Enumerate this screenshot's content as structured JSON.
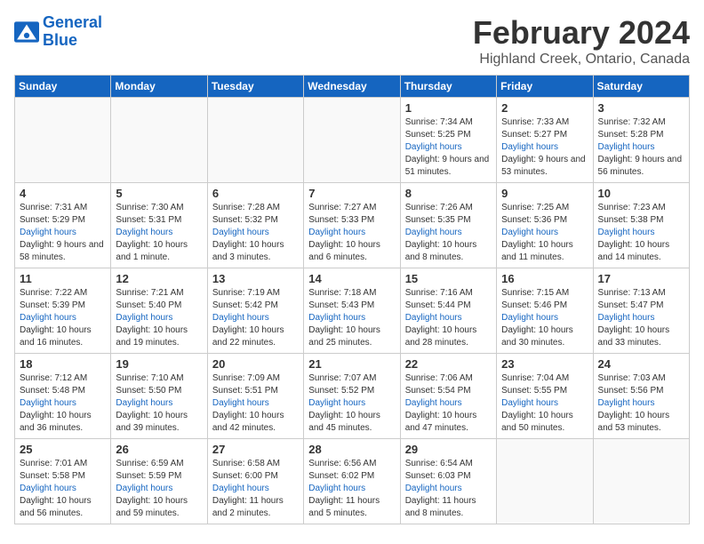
{
  "logo": {
    "line1": "General",
    "line2": "Blue"
  },
  "title": "February 2024",
  "location": "Highland Creek, Ontario, Canada",
  "days_of_week": [
    "Sunday",
    "Monday",
    "Tuesday",
    "Wednesday",
    "Thursday",
    "Friday",
    "Saturday"
  ],
  "weeks": [
    [
      {
        "num": "",
        "sunrise": "",
        "sunset": "",
        "daylight": ""
      },
      {
        "num": "",
        "sunrise": "",
        "sunset": "",
        "daylight": ""
      },
      {
        "num": "",
        "sunrise": "",
        "sunset": "",
        "daylight": ""
      },
      {
        "num": "",
        "sunrise": "",
        "sunset": "",
        "daylight": ""
      },
      {
        "num": "1",
        "sunrise": "Sunrise: 7:34 AM",
        "sunset": "Sunset: 5:25 PM",
        "daylight": "Daylight: 9 hours and 51 minutes."
      },
      {
        "num": "2",
        "sunrise": "Sunrise: 7:33 AM",
        "sunset": "Sunset: 5:27 PM",
        "daylight": "Daylight: 9 hours and 53 minutes."
      },
      {
        "num": "3",
        "sunrise": "Sunrise: 7:32 AM",
        "sunset": "Sunset: 5:28 PM",
        "daylight": "Daylight: 9 hours and 56 minutes."
      }
    ],
    [
      {
        "num": "4",
        "sunrise": "Sunrise: 7:31 AM",
        "sunset": "Sunset: 5:29 PM",
        "daylight": "Daylight: 9 hours and 58 minutes."
      },
      {
        "num": "5",
        "sunrise": "Sunrise: 7:30 AM",
        "sunset": "Sunset: 5:31 PM",
        "daylight": "Daylight: 10 hours and 1 minute."
      },
      {
        "num": "6",
        "sunrise": "Sunrise: 7:28 AM",
        "sunset": "Sunset: 5:32 PM",
        "daylight": "Daylight: 10 hours and 3 minutes."
      },
      {
        "num": "7",
        "sunrise": "Sunrise: 7:27 AM",
        "sunset": "Sunset: 5:33 PM",
        "daylight": "Daylight: 10 hours and 6 minutes."
      },
      {
        "num": "8",
        "sunrise": "Sunrise: 7:26 AM",
        "sunset": "Sunset: 5:35 PM",
        "daylight": "Daylight: 10 hours and 8 minutes."
      },
      {
        "num": "9",
        "sunrise": "Sunrise: 7:25 AM",
        "sunset": "Sunset: 5:36 PM",
        "daylight": "Daylight: 10 hours and 11 minutes."
      },
      {
        "num": "10",
        "sunrise": "Sunrise: 7:23 AM",
        "sunset": "Sunset: 5:38 PM",
        "daylight": "Daylight: 10 hours and 14 minutes."
      }
    ],
    [
      {
        "num": "11",
        "sunrise": "Sunrise: 7:22 AM",
        "sunset": "Sunset: 5:39 PM",
        "daylight": "Daylight: 10 hours and 16 minutes."
      },
      {
        "num": "12",
        "sunrise": "Sunrise: 7:21 AM",
        "sunset": "Sunset: 5:40 PM",
        "daylight": "Daylight: 10 hours and 19 minutes."
      },
      {
        "num": "13",
        "sunrise": "Sunrise: 7:19 AM",
        "sunset": "Sunset: 5:42 PM",
        "daylight": "Daylight: 10 hours and 22 minutes."
      },
      {
        "num": "14",
        "sunrise": "Sunrise: 7:18 AM",
        "sunset": "Sunset: 5:43 PM",
        "daylight": "Daylight: 10 hours and 25 minutes."
      },
      {
        "num": "15",
        "sunrise": "Sunrise: 7:16 AM",
        "sunset": "Sunset: 5:44 PM",
        "daylight": "Daylight: 10 hours and 28 minutes."
      },
      {
        "num": "16",
        "sunrise": "Sunrise: 7:15 AM",
        "sunset": "Sunset: 5:46 PM",
        "daylight": "Daylight: 10 hours and 30 minutes."
      },
      {
        "num": "17",
        "sunrise": "Sunrise: 7:13 AM",
        "sunset": "Sunset: 5:47 PM",
        "daylight": "Daylight: 10 hours and 33 minutes."
      }
    ],
    [
      {
        "num": "18",
        "sunrise": "Sunrise: 7:12 AM",
        "sunset": "Sunset: 5:48 PM",
        "daylight": "Daylight: 10 hours and 36 minutes."
      },
      {
        "num": "19",
        "sunrise": "Sunrise: 7:10 AM",
        "sunset": "Sunset: 5:50 PM",
        "daylight": "Daylight: 10 hours and 39 minutes."
      },
      {
        "num": "20",
        "sunrise": "Sunrise: 7:09 AM",
        "sunset": "Sunset: 5:51 PM",
        "daylight": "Daylight: 10 hours and 42 minutes."
      },
      {
        "num": "21",
        "sunrise": "Sunrise: 7:07 AM",
        "sunset": "Sunset: 5:52 PM",
        "daylight": "Daylight: 10 hours and 45 minutes."
      },
      {
        "num": "22",
        "sunrise": "Sunrise: 7:06 AM",
        "sunset": "Sunset: 5:54 PM",
        "daylight": "Daylight: 10 hours and 47 minutes."
      },
      {
        "num": "23",
        "sunrise": "Sunrise: 7:04 AM",
        "sunset": "Sunset: 5:55 PM",
        "daylight": "Daylight: 10 hours and 50 minutes."
      },
      {
        "num": "24",
        "sunrise": "Sunrise: 7:03 AM",
        "sunset": "Sunset: 5:56 PM",
        "daylight": "Daylight: 10 hours and 53 minutes."
      }
    ],
    [
      {
        "num": "25",
        "sunrise": "Sunrise: 7:01 AM",
        "sunset": "Sunset: 5:58 PM",
        "daylight": "Daylight: 10 hours and 56 minutes."
      },
      {
        "num": "26",
        "sunrise": "Sunrise: 6:59 AM",
        "sunset": "Sunset: 5:59 PM",
        "daylight": "Daylight: 10 hours and 59 minutes."
      },
      {
        "num": "27",
        "sunrise": "Sunrise: 6:58 AM",
        "sunset": "Sunset: 6:00 PM",
        "daylight": "Daylight: 11 hours and 2 minutes."
      },
      {
        "num": "28",
        "sunrise": "Sunrise: 6:56 AM",
        "sunset": "Sunset: 6:02 PM",
        "daylight": "Daylight: 11 hours and 5 minutes."
      },
      {
        "num": "29",
        "sunrise": "Sunrise: 6:54 AM",
        "sunset": "Sunset: 6:03 PM",
        "daylight": "Daylight: 11 hours and 8 minutes."
      },
      {
        "num": "",
        "sunrise": "",
        "sunset": "",
        "daylight": ""
      },
      {
        "num": "",
        "sunrise": "",
        "sunset": "",
        "daylight": ""
      }
    ]
  ]
}
